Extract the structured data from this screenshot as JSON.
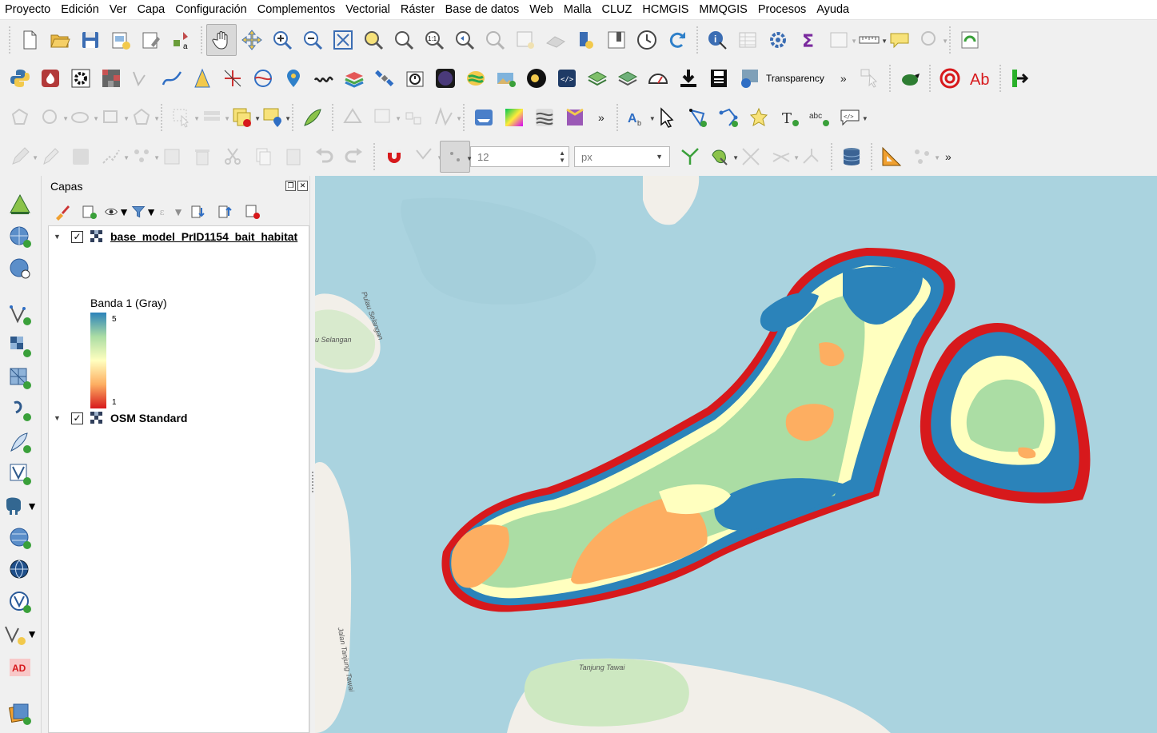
{
  "menu": [
    "Proyecto",
    "Edición",
    "Ver",
    "Capa",
    "Configuración",
    "Complementos",
    "Vectorial",
    "Ráster",
    "Base de datos",
    "Web",
    "Malla",
    "CLUZ",
    "HCMGIS",
    "MMQGIS",
    "Procesos",
    "Ayuda"
  ],
  "toolbar2": {
    "transparency_label": "Transparency"
  },
  "toolbar4": {
    "size_value": "12",
    "unit_value": "px"
  },
  "layers_panel": {
    "title": "Capas",
    "layers": [
      {
        "name": "base_model_PrID1154_bait_habitat",
        "checked": true,
        "legend_title": "Banda 1 (Gray)",
        "ramp_max": "5",
        "ramp_min": "1"
      },
      {
        "name": "OSM Standard",
        "checked": true
      }
    ]
  },
  "map": {
    "labels": [
      "Pulau Selangan",
      "u Selangan",
      "Tanjung Tawai",
      "Jalan Tanjung Tawai"
    ]
  },
  "colors": {
    "water": "#aad3df",
    "land": "#f2efe9",
    "class1": "#d7191c",
    "class2": "#fdae61",
    "class3": "#ffffbf",
    "class4": "#abdda4",
    "class5": "#2b83ba"
  }
}
